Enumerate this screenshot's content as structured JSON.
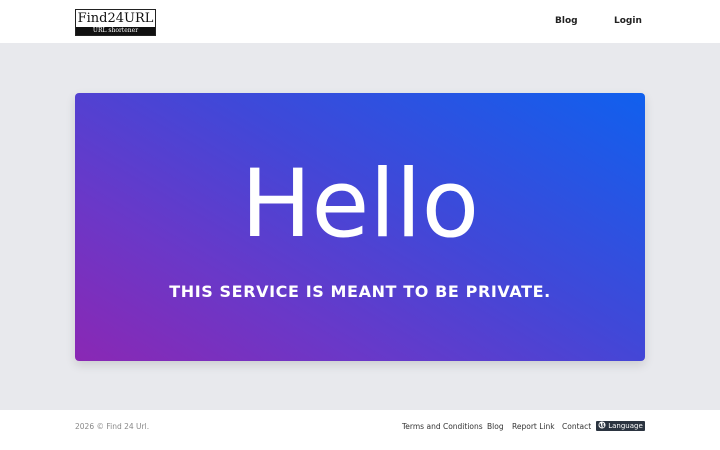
{
  "header": {
    "logo_name": "Find24URL",
    "logo_tagline": "URL shortener",
    "nav": {
      "blog": "Blog",
      "login": "Login"
    }
  },
  "hero": {
    "title": "Hello",
    "subtitle": "THIS SERVICE IS MEANT TO BE PRIVATE.",
    "gradient_colors": [
      "#8a28b4",
      "#4048d8",
      "#1060ee"
    ]
  },
  "footer": {
    "copyright": "2026 © Find 24 Url.",
    "links": {
      "terms": "Terms and Conditions",
      "blog": "Blog",
      "report": "Report Link",
      "contact": "Contact"
    },
    "language_label": "Language",
    "language_icon": "globe-icon"
  }
}
